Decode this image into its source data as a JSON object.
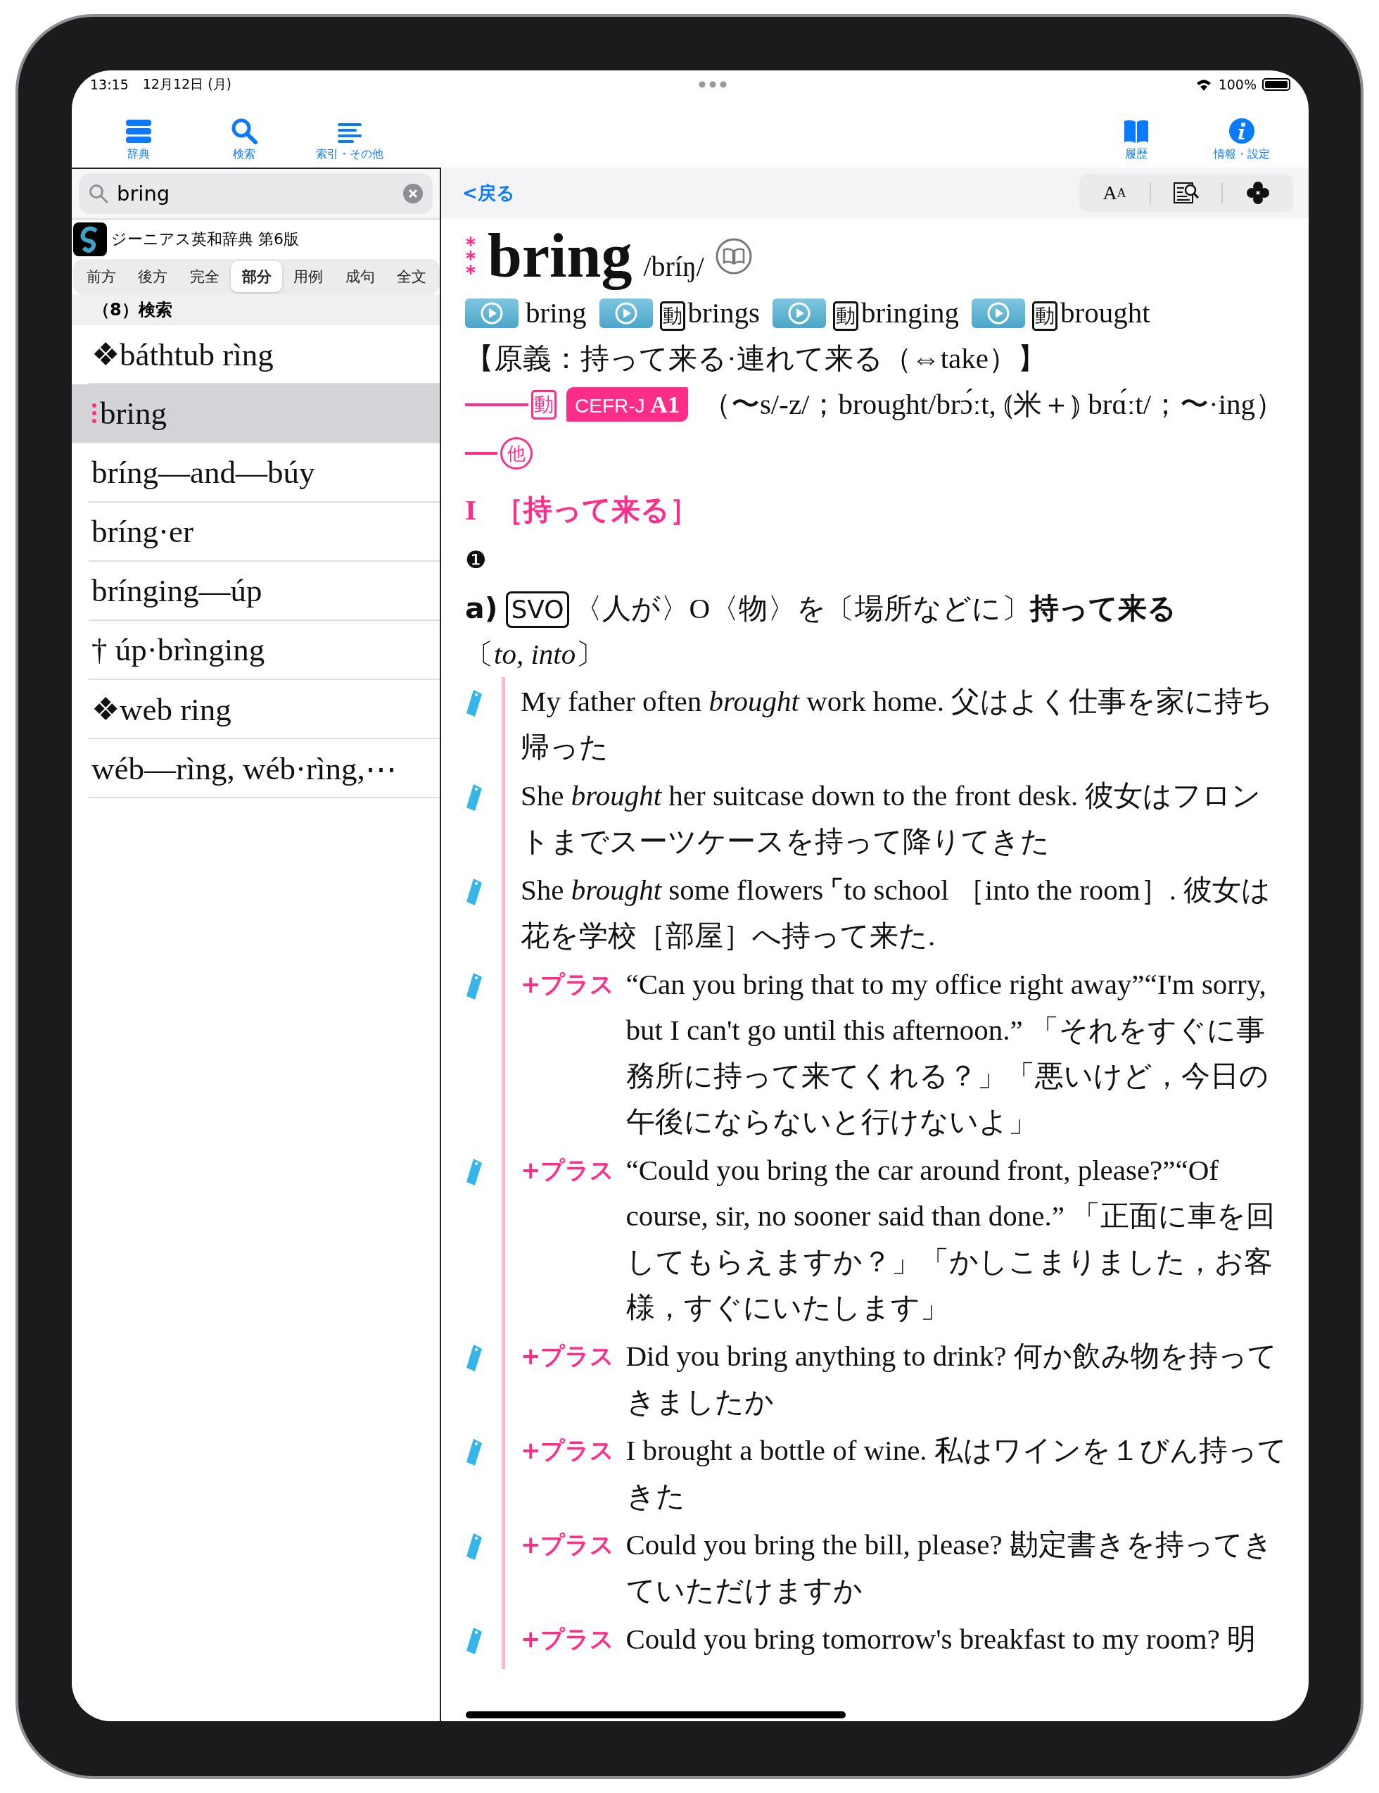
{
  "status_bar": {
    "time": "13:15",
    "date": "12月12日 (月)",
    "battery": "100%"
  },
  "toolbar": {
    "left": [
      {
        "kind": "stack",
        "label": "辞典"
      },
      {
        "kind": "search",
        "label": "検索"
      },
      {
        "kind": "list",
        "label": "索引・その他"
      }
    ],
    "right": [
      {
        "kind": "book",
        "label": "履歴"
      },
      {
        "kind": "info",
        "label": "情報・設定"
      }
    ]
  },
  "sidebar": {
    "search": {
      "value": "bring"
    },
    "dictionary": "ジーニアス英和辞典 第6版",
    "modes": [
      {
        "label": "前方",
        "selected": false
      },
      {
        "label": "後方",
        "selected": false
      },
      {
        "label": "完全",
        "selected": false
      },
      {
        "label": "部分",
        "selected": true
      },
      {
        "label": "用例",
        "selected": false
      },
      {
        "label": "成句",
        "selected": false
      },
      {
        "label": "全文",
        "selected": false
      }
    ],
    "result_header": "（8）検索",
    "results": [
      {
        "text": "❖báthtub rìng",
        "selected": false,
        "marked": false
      },
      {
        "text": "bring",
        "selected": true,
        "marked": true
      },
      {
        "text": "bríng—and—búy",
        "selected": false,
        "marked": false
      },
      {
        "text": "bríng·er",
        "selected": false,
        "marked": false
      },
      {
        "text": "brínging—úp",
        "selected": false,
        "marked": false
      },
      {
        "text": "† úp·brìnging",
        "selected": false,
        "marked": false
      },
      {
        "text": "❖web ring",
        "selected": false,
        "marked": false
      },
      {
        "text": "wéb—rìng, wéb·rìng,⋯",
        "selected": false,
        "marked": false
      }
    ]
  },
  "entry_toolbar": {
    "back": "<戻る",
    "text_size_button": {
      "big": "A",
      "small": "A"
    }
  },
  "entry": {
    "headword": "bring",
    "pronunciation": "/bríŋ/",
    "forms": [
      {
        "word": "bring"
      },
      {
        "tag": "動",
        "word": "brings"
      },
      {
        "tag": "動",
        "word": "bringing"
      },
      {
        "tag": "動",
        "word": "brought"
      }
    ],
    "etymology": "【原義：持って来る·連れて来る（⇔take）】",
    "pos": "動",
    "cefr": {
      "label": "CEFR-J",
      "level": "A1"
    },
    "inflections": "（〜s/-z/；brought/brɔ́ːt, ⦅米＋⦆ brɑ́ːt/；〜·ing）",
    "subpos": "他",
    "sense": {
      "numeral": "I",
      "label": "［持って来る］"
    },
    "number": "❶",
    "subsense": {
      "letter": "a)",
      "pattern": "SVO",
      "definition": "〈人が〉O〈物〉を〔場所などに〕**持って来る**",
      "prepositions": "〔*to, into*〕"
    },
    "examples": [
      {
        "kind": "plain",
        "text": "My father often *brought* work home.  父はよく仕事を家に持ち帰った"
      },
      {
        "kind": "plain",
        "text": "She *brought* her suitcase down to the front desk.  彼女はフロントまでスーツケースを持って降りてきた"
      },
      {
        "kind": "plain",
        "text": "She *brought* some flowers ⌜to school ［into the room］.  彼女は花を学校［部屋］へ持って来た."
      },
      {
        "kind": "plus",
        "tag": "+プラス",
        "text": "“Can you bring that to my office right away”“I'm sorry, but I can't go until this afternoon.” 「それをすぐに事務所に持って来てくれる？」「悪いけど，今日の午後にならないと行けないよ」"
      },
      {
        "kind": "plus",
        "tag": "+プラス",
        "text": "“Could you bring the car around front, please?”“Of course, sir, no sooner said than done.” 「正面に車を回してもらえますか？」「かしこまりました，お客様，すぐにいたします」"
      },
      {
        "kind": "plus",
        "tag": "+プラス",
        "text": "Did you bring anything to drink?  何か飲み物を持ってきましたか"
      },
      {
        "kind": "plus",
        "tag": "+プラス",
        "text": "I brought a bottle of wine.  私はワインを１びん持ってきた"
      },
      {
        "kind": "plus",
        "tag": "+プラス",
        "text": "Could you bring the bill, please?  勘定書きを持ってきていただけますか"
      },
      {
        "kind": "plus",
        "tag": "+プラス",
        "text": "Could you bring tomorrow's breakfast to my room?  明"
      }
    ]
  }
}
